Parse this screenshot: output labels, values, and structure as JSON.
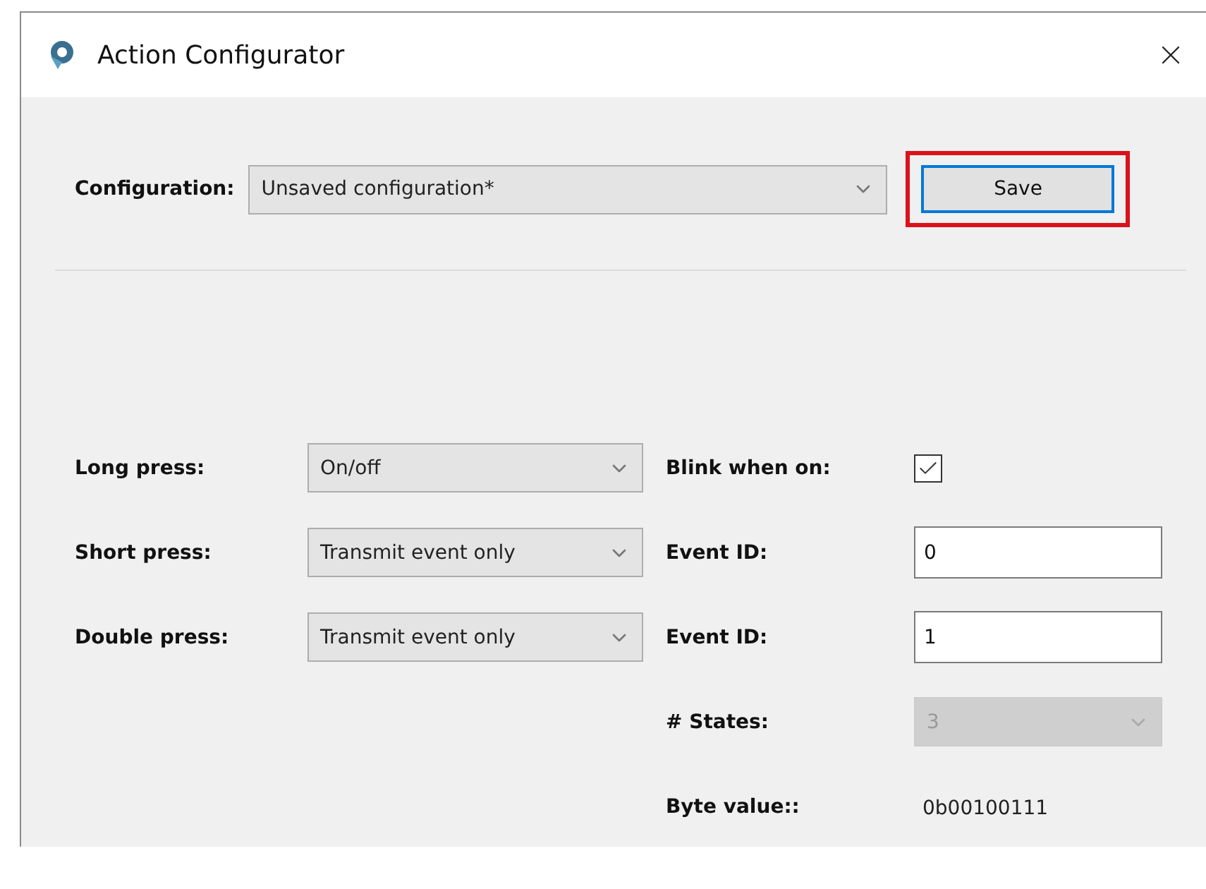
{
  "window": {
    "title": "Action Configurator"
  },
  "configuration": {
    "label": "Configuration:",
    "value": "Unsaved configuration*",
    "save_button": {
      "label": "Save",
      "highlighted": true
    }
  },
  "left_rows": [
    {
      "label": "Long press:",
      "value": "On/off"
    },
    {
      "label": "Short press:",
      "value": "Transmit event only"
    },
    {
      "label": "Double press:",
      "value": "Transmit event only"
    }
  ],
  "right_rows": [
    {
      "kind": "checkbox",
      "label": "Blink when on:",
      "checked": true
    },
    {
      "kind": "text",
      "label": "Event ID:",
      "value": "0"
    },
    {
      "kind": "text",
      "label": "Event ID:",
      "value": "1"
    },
    {
      "kind": "select",
      "label": "# States:",
      "value": "3",
      "disabled": true
    },
    {
      "kind": "value",
      "label": "Byte value::",
      "value": "0b00100111"
    }
  ]
}
